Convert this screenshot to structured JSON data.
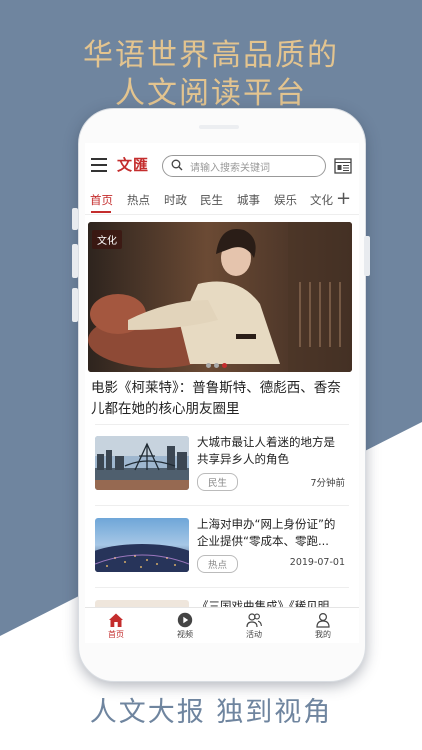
{
  "promo": {
    "headline_1": "华语世界高品质的",
    "headline_2": "人文阅读平台",
    "tagline": "人文大报 独到视角"
  },
  "app": {
    "logo_text": "文匯",
    "search_placeholder": "请输入搜索关键词",
    "accent_color": "#c42d2d"
  },
  "tabs": [
    {
      "label": "首页",
      "active": true
    },
    {
      "label": "热点"
    },
    {
      "label": "时政"
    },
    {
      "label": "民生"
    },
    {
      "label": "城事"
    },
    {
      "label": "娱乐"
    },
    {
      "label": "文化"
    }
  ],
  "hero": {
    "badge": "文化",
    "title": "电影《柯莱特》：普鲁斯特、德彪西、香奈儿都在她的核心朋友圈里",
    "slides": 3,
    "active_slide": 3
  },
  "news": [
    {
      "title": "大城市最让人着迷的地方是共享异乡人的角色",
      "tag": "民生",
      "meta": "7分钟前"
    },
    {
      "title": "上海对申办“网上身份证”的企业提供“零成本、零跑...",
      "tag": "热点",
      "meta": "2019-07-01"
    },
    {
      "title": "《三国戏曲集成》《稀见明"
    }
  ],
  "bottom_nav": [
    {
      "label": "首页",
      "icon": "home-icon",
      "active": true
    },
    {
      "label": "视频",
      "icon": "play-icon"
    },
    {
      "label": "活动",
      "icon": "people-icon"
    },
    {
      "label": "我的",
      "icon": "user-icon"
    }
  ]
}
